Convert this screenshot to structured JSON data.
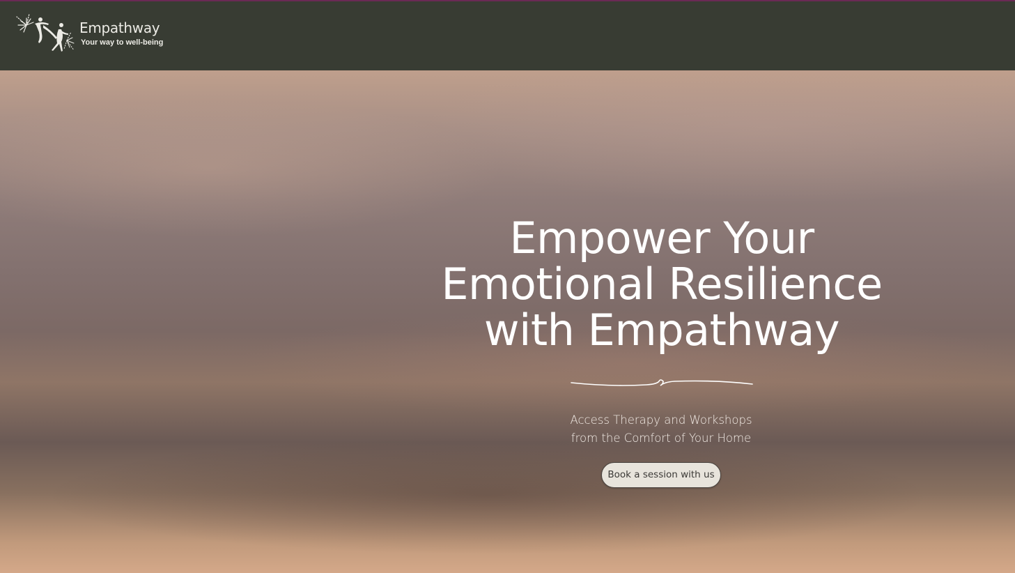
{
  "header": {
    "brand_name": "Empathway",
    "tagline": "Your way to well-being",
    "logo_icon": "dancing-figures-sparkle-icon"
  },
  "hero": {
    "title": "Empower Your Emotional Resilience with Empathway",
    "subtitle_line1": "Access Therapy and Workshops",
    "subtitle_line2": "from the Comfort of Your Home",
    "cta_label": "Book a session with us",
    "divider_icon": "squiggle-divider-icon"
  },
  "colors": {
    "header_bg": "#383c33",
    "header_accent": "#6a2a55",
    "button_bg": "#e8e4dc",
    "text_light": "#ffffff"
  }
}
